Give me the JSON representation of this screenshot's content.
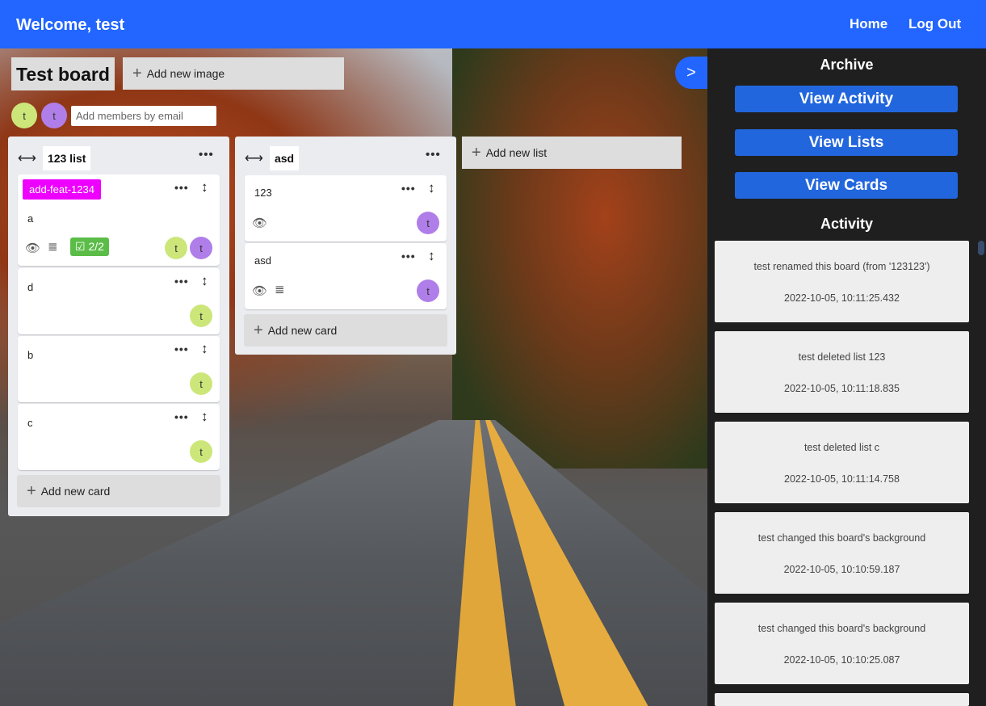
{
  "header": {
    "welcome": "Welcome, test",
    "home": "Home",
    "logout": "Log Out"
  },
  "board": {
    "title": "Test board",
    "add_image": "Add new image",
    "members": [
      "t",
      "t"
    ],
    "members_placeholder": "Add members by email",
    "add_list": "Add new list"
  },
  "lists": [
    {
      "title": "123 list",
      "add_card": "Add new card",
      "cards": [
        {
          "tag": "add-feat-1234",
          "title": "a",
          "checklist": "2/2",
          "members": [
            "t",
            "t"
          ]
        },
        {
          "title": "d",
          "members": [
            "t"
          ]
        },
        {
          "title": "b",
          "members": [
            "t"
          ]
        },
        {
          "title": "c",
          "members": [
            "t"
          ]
        }
      ]
    },
    {
      "title": "asd",
      "add_card": "Add new card",
      "cards": [
        {
          "title": "123",
          "members": [
            "t"
          ]
        },
        {
          "title": "asd",
          "members": [
            "t"
          ]
        }
      ]
    }
  ],
  "sidebar": {
    "toggle": ">",
    "archive": "Archive",
    "view_activity": "View Activity",
    "view_lists": "View Lists",
    "view_cards": "View Cards",
    "activity_heading": "Activity",
    "activity": [
      {
        "text": "test renamed this board (from '123123')",
        "time": "2022-10-05, 10:11:25.432"
      },
      {
        "text": "test deleted list 123",
        "time": "2022-10-05, 10:11:18.835"
      },
      {
        "text": "test deleted list c",
        "time": "2022-10-05, 10:11:14.758"
      },
      {
        "text": "test changed this board's background",
        "time": "2022-10-05, 10:10:59.187"
      },
      {
        "text": "test changed this board's background",
        "time": "2022-10-05, 10:10:25.087"
      }
    ]
  }
}
